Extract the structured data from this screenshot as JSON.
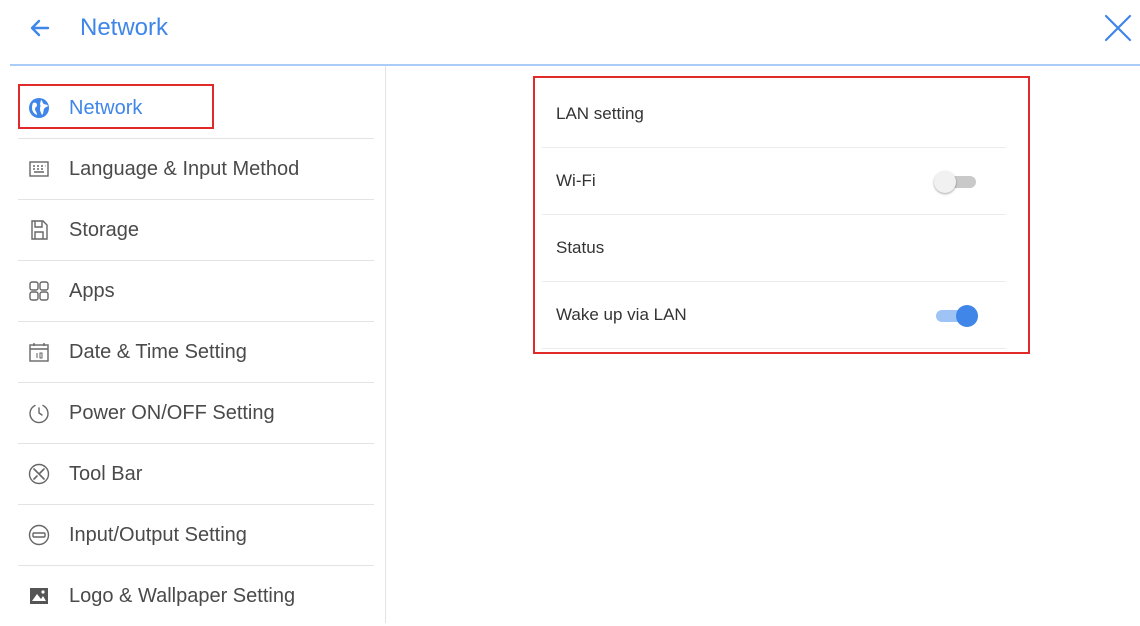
{
  "header": {
    "title": "Network",
    "back_icon": "arrow-left-icon",
    "close_icon": "close-icon",
    "accent_color": "#3f86e8"
  },
  "sidebar": {
    "items": [
      {
        "label": "Network",
        "icon": "globe-icon",
        "active": true
      },
      {
        "label": "Language & Input Method",
        "icon": "keyboard-icon"
      },
      {
        "label": "Storage",
        "icon": "storage-icon"
      },
      {
        "label": "Apps",
        "icon": "apps-grid-icon"
      },
      {
        "label": "Date & Time Setting",
        "icon": "calendar-icon"
      },
      {
        "label": "Power ON/OFF Setting",
        "icon": "power-timer-icon"
      },
      {
        "label": "Tool Bar",
        "icon": "tools-icon"
      },
      {
        "label": "Input/Output Setting",
        "icon": "input-output-icon"
      },
      {
        "label": "Logo & Wallpaper Setting",
        "icon": "image-icon"
      }
    ]
  },
  "network_panel": {
    "rows": [
      {
        "label": "LAN setting"
      },
      {
        "label": "Wi-Fi",
        "toggle": "off"
      },
      {
        "label": "Status"
      },
      {
        "label": "Wake up via LAN",
        "toggle": "on"
      }
    ]
  },
  "highlight_color": "#e02a2a"
}
